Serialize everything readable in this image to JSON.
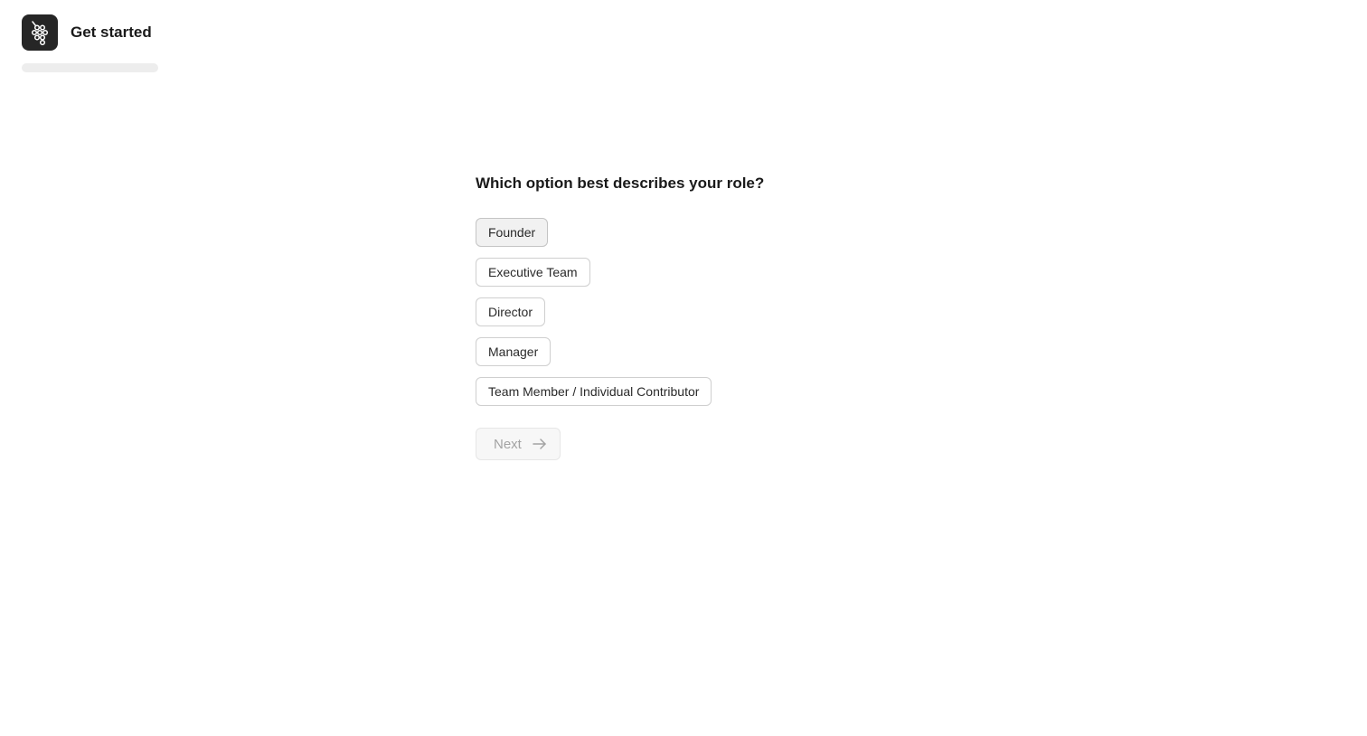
{
  "header": {
    "title": "Get started",
    "logo_icon": "grape-cluster-icon"
  },
  "progress": {
    "fraction": 0.0
  },
  "question": {
    "text": "Which option best describes your role?"
  },
  "options": [
    {
      "label": "Founder",
      "selected": true
    },
    {
      "label": "Executive Team",
      "selected": false
    },
    {
      "label": "Director",
      "selected": false
    },
    {
      "label": "Manager",
      "selected": false
    },
    {
      "label": "Team Member / Individual Contributor",
      "selected": false
    }
  ],
  "next_button": {
    "label": "Next",
    "icon": "arrow-right-icon",
    "disabled": true
  },
  "colors": {
    "logo_bg": "#262626",
    "text": "#1a1a1a",
    "border": "#cfcfcf",
    "disabled_text": "#a3a3a3"
  }
}
